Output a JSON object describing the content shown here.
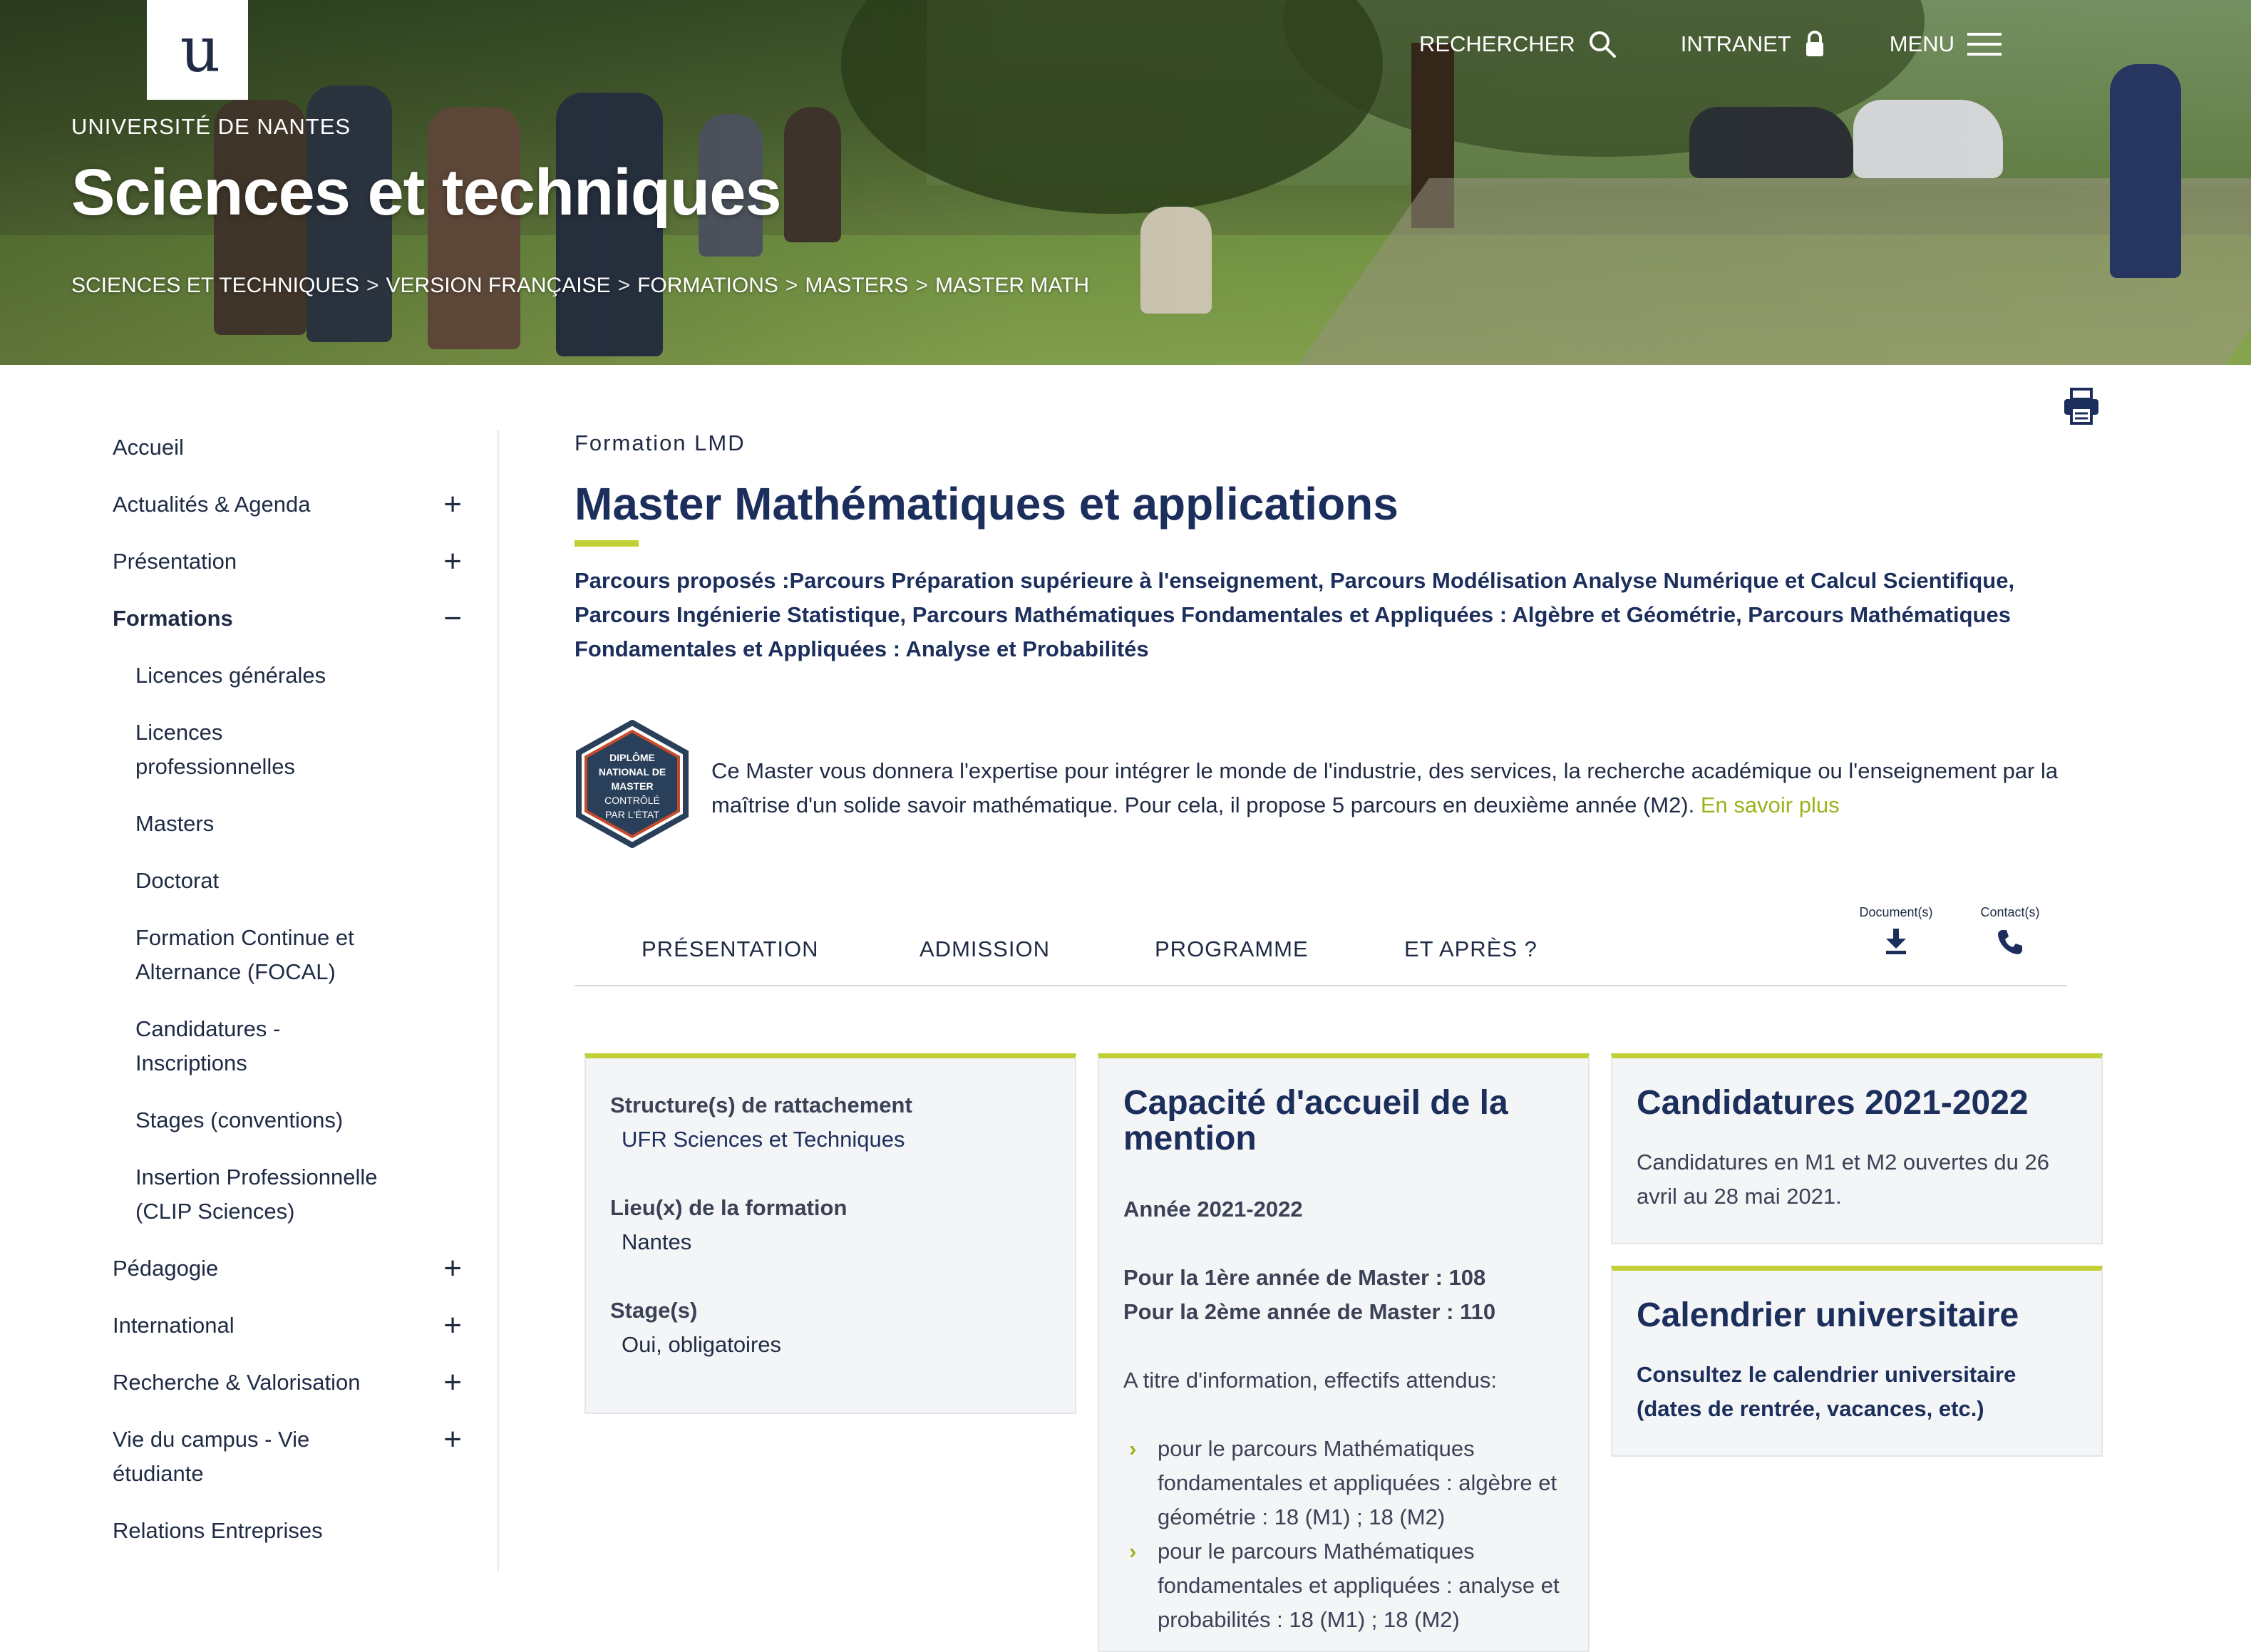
{
  "header": {
    "logo_text": "u",
    "university": "UNIVERSITÉ DE NANTES",
    "site_title": "Sciences et techniques",
    "nav": {
      "search_label": "RECHERCHER",
      "intranet_label": "INTRANET",
      "menu_label": "MENU"
    },
    "breadcrumb": [
      "SCIENCES ET TECHNIQUES",
      "VERSION FRANÇAISE",
      "FORMATIONS",
      "MASTERS",
      "MASTER MATH"
    ],
    "breadcrumb_separator": ">"
  },
  "sidebar": {
    "items": [
      {
        "label": "Accueil",
        "toggle": ""
      },
      {
        "label": "Actualités & Agenda",
        "toggle": "+"
      },
      {
        "label": "Présentation",
        "toggle": "+"
      },
      {
        "label": "Formations",
        "toggle": "−"
      }
    ],
    "sub_items": [
      "Licences générales",
      "Licences professionnelles",
      "Masters",
      "Doctorat",
      "Formation Continue et Alternance (FOCAL)",
      "Candidatures - Inscriptions",
      "Stages (conventions)",
      "Insertion Professionnelle (CLIP Sciences)"
    ],
    "items_after": [
      {
        "label": "Pédagogie",
        "toggle": "+"
      },
      {
        "label": "International",
        "toggle": "+"
      },
      {
        "label": "Recherche & Valorisation",
        "toggle": "+"
      },
      {
        "label": "Vie du campus - Vie étudiante",
        "toggle": "+"
      },
      {
        "label": "Relations Entreprises",
        "toggle": ""
      }
    ]
  },
  "main": {
    "eyebrow": "Formation LMD",
    "title": "Master Mathématiques et applications",
    "parcours": "Parcours proposés :Parcours Préparation supérieure à l'enseignement, Parcours Modélisation Analyse Numérique et Calcul Scientifique, Parcours Ingénierie Statistique, Parcours Mathématiques Fondamentales et Appliquées : Algèbre et Géométrie, Parcours Mathématiques Fondamentales et Appliquées : Analyse et Probabilités",
    "badge_lines": [
      "DIPLÔME",
      "NATIONAL DE",
      "MASTER",
      "CONTRÔLÉ",
      "PAR L'ÉTAT"
    ],
    "intro": "Ce Master vous donnera l'expertise pour intégrer le monde de l'industrie, des services, la recherche académique ou l'enseignement par la maîtrise d'un solide savoir mathématique. Pour cela, il propose 5 parcours en deuxième année (M2).",
    "intro_link": "En savoir plus",
    "tabs": [
      "PRÉSENTATION",
      "ADMISSION",
      "PROGRAMME",
      "ET APRÈS ?"
    ],
    "tab_actions": {
      "documents": "Document(s)",
      "contacts": "Contact(s)"
    }
  },
  "cards": {
    "structure": {
      "structure_label": "Structure(s) de rattachement",
      "structure_value": "UFR Sciences et Techniques",
      "lieu_label": "Lieu(x) de la formation",
      "lieu_value": "Nantes",
      "stage_label": "Stage(s)",
      "stage_value": "Oui, obligatoires"
    },
    "capacite": {
      "title": "Capacité d'accueil de la mention",
      "year": "Année 2021-2022",
      "line1": "Pour la 1ère année de Master : 108",
      "line2": "Pour la 2ème année de Master : 110",
      "info": "A titre d'information, effectifs attendus:",
      "bullets": [
        "pour le parcours Mathématiques fondamentales et appliquées : algèbre et géométrie : 18 (M1) ; 18 (M2)",
        "pour le parcours Mathématiques fondamentales et appliquées : analyse et probabilités : 18 (M1) ; 18 (M2)"
      ]
    },
    "candidatures": {
      "title": "Candidatures 2021-2022",
      "text": "Candidatures en M1 et M2 ouvertes du 26 avril au 28 mai 2021."
    },
    "calendrier": {
      "title": "Calendrier universitaire",
      "link": "Consultez le calendrier universitaire (dates de rentrée, vacances, etc.)"
    }
  }
}
